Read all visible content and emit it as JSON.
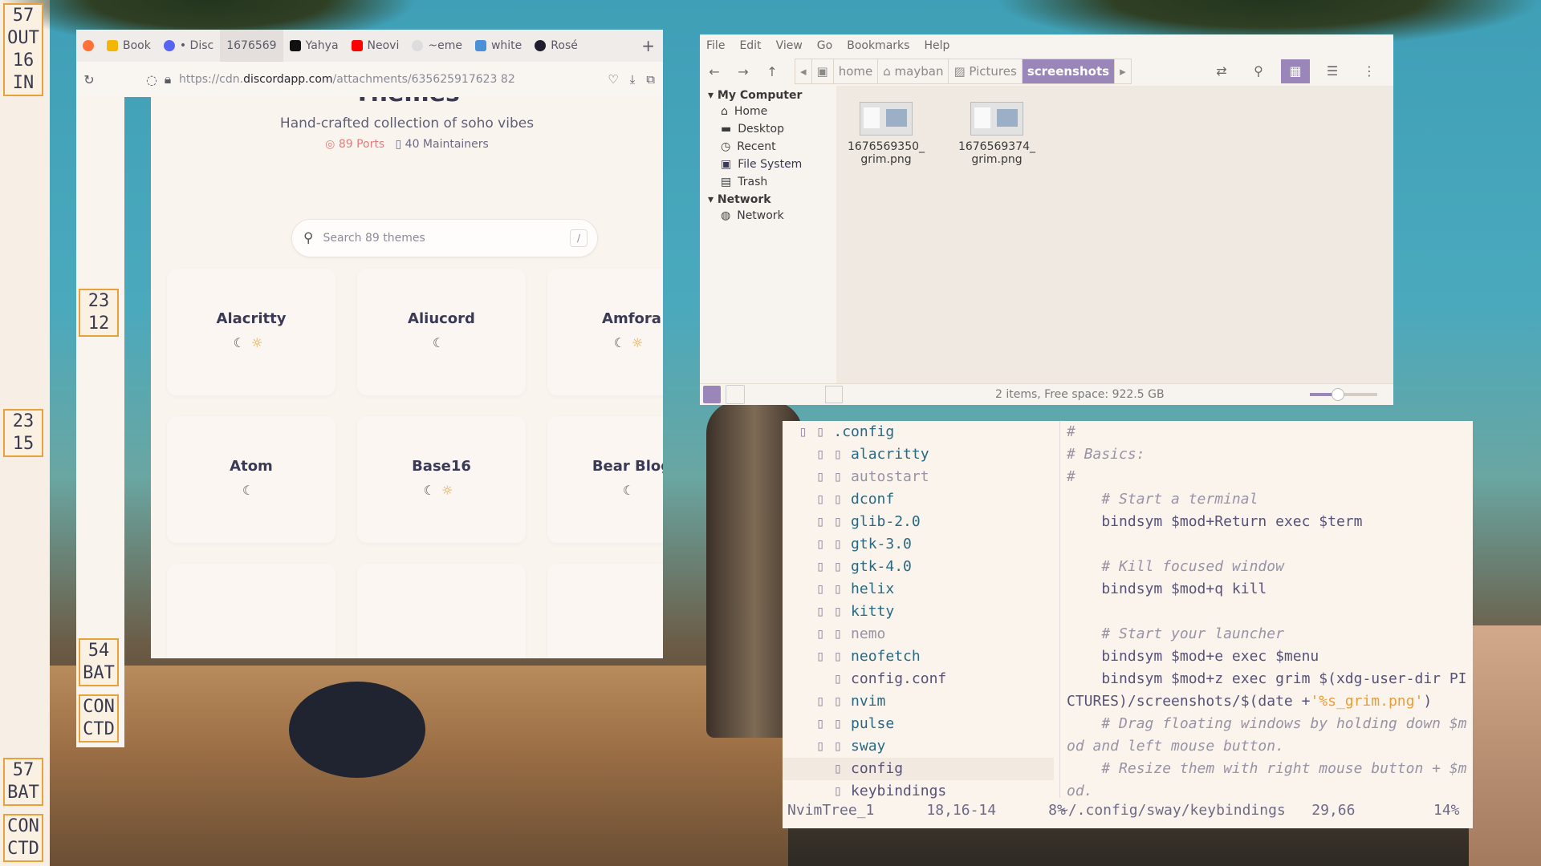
{
  "sidebar_left": {
    "modules": [
      [
        "57",
        "OUT",
        "16",
        "IN"
      ],
      [
        "23",
        "15"
      ],
      [
        "57",
        "BAT"
      ],
      [
        "CON",
        "CTD"
      ]
    ]
  },
  "sidebar_inner": {
    "modules": [
      [
        "23",
        "12"
      ],
      [
        "54",
        "BAT"
      ],
      [
        "CON",
        "CTD"
      ]
    ]
  },
  "firefox": {
    "tabs": [
      {
        "label": "Book",
        "color": "#f2b705"
      },
      {
        "label": "• Disc",
        "color": "#5865f2"
      },
      {
        "label": "1676569",
        "color": "#ffffff"
      },
      {
        "label": "Yahya",
        "color": "#111111"
      },
      {
        "label": "Neovi",
        "color": "#ff0000"
      },
      {
        "label": "~eme",
        "color": "#dddddd"
      },
      {
        "label": "white",
        "color": "#4a90d9"
      },
      {
        "label": "Rosé",
        "color": "#1f1d2e"
      }
    ],
    "url_prefix": "https://cdn.",
    "url_domain": "discordapp.com",
    "url_rest": "/attachments/635625917623 82",
    "page": {
      "heading": "Themes",
      "subtitle": "Hand-crafted collection of soho vibes",
      "ports": "89 Ports",
      "maintainers": "40 Maintainers",
      "search_placeholder": "Search 89 themes",
      "search_shortcut": "/",
      "cards": [
        {
          "title": "Alacritty",
          "icons": "☾☼"
        },
        {
          "title": "Aliucord",
          "icons": "☾"
        },
        {
          "title": "Amfora",
          "icons": "☾☼"
        },
        {
          "title": "Atom",
          "icons": "☾"
        },
        {
          "title": "Base16",
          "icons": "☾☼"
        },
        {
          "title": "Bear Blog",
          "icons": "☾"
        }
      ]
    }
  },
  "nemo": {
    "menu": [
      "File",
      "Edit",
      "View",
      "Go",
      "Bookmarks",
      "Help"
    ],
    "breadcrumbs": [
      "home",
      "mayban",
      "Pictures",
      "screenshots"
    ],
    "places": {
      "my_computer": "My Computer",
      "items": [
        "Home",
        "Desktop",
        "Recent",
        "File System",
        "Trash"
      ],
      "network_head": "Network",
      "network_items": [
        "Network"
      ]
    },
    "files": [
      {
        "line1": "1676569350_",
        "line2": "grim.png"
      },
      {
        "line1": "1676569374_",
        "line2": "grim.png"
      }
    ],
    "status": "2 items, Free space: 922.5 GB",
    "zoom_level": 0.4
  },
  "nvim": {
    "tree": [
      {
        "name": ".config",
        "indent": 0,
        "type": "dir"
      },
      {
        "name": "alacritty",
        "indent": 1,
        "type": "dir"
      },
      {
        "name": "autostart",
        "indent": 1,
        "type": "dir-muted"
      },
      {
        "name": "dconf",
        "indent": 1,
        "type": "dir"
      },
      {
        "name": "glib-2.0",
        "indent": 1,
        "type": "dir"
      },
      {
        "name": "gtk-3.0",
        "indent": 1,
        "type": "dir"
      },
      {
        "name": "gtk-4.0",
        "indent": 1,
        "type": "dir"
      },
      {
        "name": "helix",
        "indent": 1,
        "type": "dir"
      },
      {
        "name": "kitty",
        "indent": 1,
        "type": "dir"
      },
      {
        "name": "nemo",
        "indent": 1,
        "type": "dir-muted"
      },
      {
        "name": "neofetch",
        "indent": 1,
        "type": "dir"
      },
      {
        "name": "config.conf",
        "indent": 2,
        "type": "file"
      },
      {
        "name": "nvim",
        "indent": 1,
        "type": "dir"
      },
      {
        "name": "pulse",
        "indent": 1,
        "type": "dir"
      },
      {
        "name": "sway",
        "indent": 1,
        "type": "dir"
      },
      {
        "name": "config",
        "indent": 2,
        "type": "file",
        "current": true
      },
      {
        "name": "keybindings",
        "indent": 2,
        "type": "file"
      }
    ],
    "code": [
      "#",
      "# Basics:",
      "#",
      "    # Start a terminal",
      "    bindsym $mod+Return exec $term",
      "",
      "    # Kill focused window",
      "    bindsym $mod+q kill",
      "",
      "    # Start your launcher",
      "    bindsym $mod+e exec $menu",
      "    bindsym $mod+z exec grim $(xdg-user-dir PI",
      "CTURES)/screenshots/$(date +'%s_grim.png')",
      "    # Drag floating windows by holding down $m",
      "od and left mouse button.",
      "    # Resize them with right mouse button + $m",
      "od."
    ],
    "statusline_left": "NvimTree_1      18,16-14      8%",
    "statusline_right": "~/.config/sway/keybindings   29,66         14%"
  }
}
